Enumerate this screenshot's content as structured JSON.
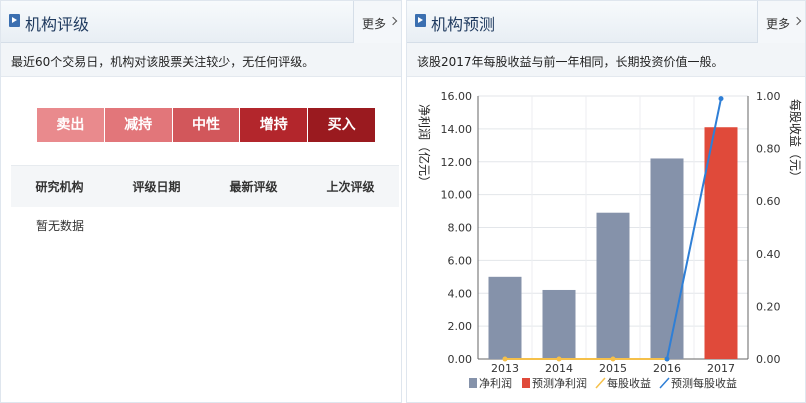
{
  "left_panel": {
    "title": "机构评级",
    "more": "更多",
    "summary": "最近60个交易日，机构对该股票关注较少，无任何评级。",
    "rating_levels": [
      {
        "label": "卖出",
        "color": "#e98a8d"
      },
      {
        "label": "减持",
        "color": "#e2767a"
      },
      {
        "label": "中性",
        "color": "#d2575b"
      },
      {
        "label": "增持",
        "color": "#b3262c"
      },
      {
        "label": "买入",
        "color": "#9a1a1f"
      }
    ],
    "table_columns": [
      "研究机构",
      "评级日期",
      "最新评级",
      "上次评级"
    ],
    "empty_text": "暂无数据"
  },
  "right_panel": {
    "title": "机构预测",
    "more": "更多",
    "summary": "该股2017年每股收益与前一年相同，长期投资价值一般。"
  },
  "chart_data": {
    "type": "bar",
    "categories": [
      "2013",
      "2014",
      "2015",
      "2016",
      "2017"
    ],
    "ylabel": "净利润（亿元）",
    "y2label": "每股收益（元）",
    "ylim": [
      0,
      16
    ],
    "y2lim": [
      0,
      1
    ],
    "yticks": [
      "0.00",
      "2.00",
      "4.00",
      "6.00",
      "8.00",
      "10.00",
      "12.00",
      "14.00",
      "16.00"
    ],
    "y2ticks": [
      "0.00",
      "0.20",
      "0.40",
      "0.60",
      "0.80",
      "1.00"
    ],
    "series": [
      {
        "name": "净利润",
        "kind": "bar",
        "color": "#8592aa",
        "values": [
          5.0,
          4.2,
          8.9,
          12.2,
          null
        ]
      },
      {
        "name": "预测净利润",
        "kind": "bar",
        "color": "#e04a3a",
        "values": [
          null,
          null,
          null,
          null,
          14.1
        ]
      },
      {
        "name": "每股收益",
        "kind": "line",
        "axis": "right",
        "color": "#f5c04a",
        "values": [
          0.0,
          0.0,
          0.0,
          0.0,
          null
        ]
      },
      {
        "name": "预测每股收益",
        "kind": "line",
        "axis": "right",
        "color": "#2f7fd6",
        "values": [
          null,
          null,
          null,
          0.0,
          0.99
        ]
      }
    ],
    "legend_position": "bottom",
    "grid": true
  }
}
